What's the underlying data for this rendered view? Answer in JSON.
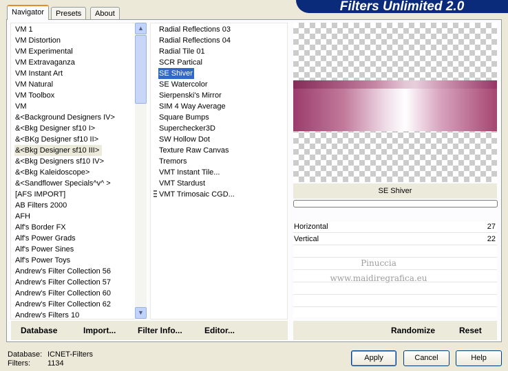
{
  "banner": {
    "title": "Filters Unlimited 2.0"
  },
  "tabs": [
    {
      "label": "Navigator"
    },
    {
      "label": "Presets"
    },
    {
      "label": "About"
    }
  ],
  "categories": [
    "VM 1",
    "VM Distortion",
    "VM Experimental",
    "VM Extravaganza",
    "VM Instant Art",
    "VM Natural",
    "VM Toolbox",
    "VM",
    "&<Background Designers IV>",
    "&<Bkg Designer sf10 I>",
    "&<BKg Designer sf10 II>",
    "&<Bkg Designer sf10 III>",
    "&<Bkg Designers sf10 IV>",
    "&<Bkg Kaleidoscope>",
    "&<Sandflower Specials^v^ >",
    "[AFS IMPORT]",
    "AB Filters 2000",
    "AFH",
    "Alf's Border FX",
    "Alf's Power Grads",
    "Alf's Power Sines",
    "Alf's Power Toys",
    "Andrew's Filter Collection 56",
    "Andrew's Filter Collection 57",
    "Andrew's Filter Collection 60",
    "Andrew's Filter Collection 62",
    "Andrew's Filters 10"
  ],
  "selected_category": "&<Bkg Designer sf10 III>",
  "filters": [
    "Radial Reflections 03",
    "Radial Reflections 04",
    "Radial Tile 01",
    "SCR  Partical",
    "SE Shiver",
    "SE Watercolor",
    "Sierpenski's Mirror",
    "SIM 4 Way Average",
    "Square Bumps",
    "Superchecker3D",
    "SW Hollow Dot",
    "Texture Raw Canvas",
    "Tremors",
    "VMT Instant Tile...",
    "VMT Stardust",
    "VMT Trimosaic CGD..."
  ],
  "selected_filter": "SE Shiver",
  "preview": {
    "filter_name": "SE Shiver"
  },
  "params": [
    {
      "label": "Horizontal",
      "value": "27"
    },
    {
      "label": "Vertical",
      "value": "22"
    }
  ],
  "watermark": {
    "line1": "Pinuccia",
    "line2": "www.maidiregrafica.eu"
  },
  "links": {
    "database": "Database",
    "import": "Import...",
    "filter_info": "Filter Info...",
    "editor": "Editor...",
    "randomize": "Randomize",
    "reset": "Reset"
  },
  "status": {
    "database_label": "Database:",
    "database_value": "ICNET-Filters",
    "filters_label": "Filters:",
    "filters_value": "1134"
  },
  "buttons": {
    "apply": "Apply",
    "cancel": "Cancel",
    "help": "Help"
  },
  "colors": {
    "selection": "#316ac5",
    "banner": "#0a2a7a",
    "shiver": "#9b3c6c"
  }
}
